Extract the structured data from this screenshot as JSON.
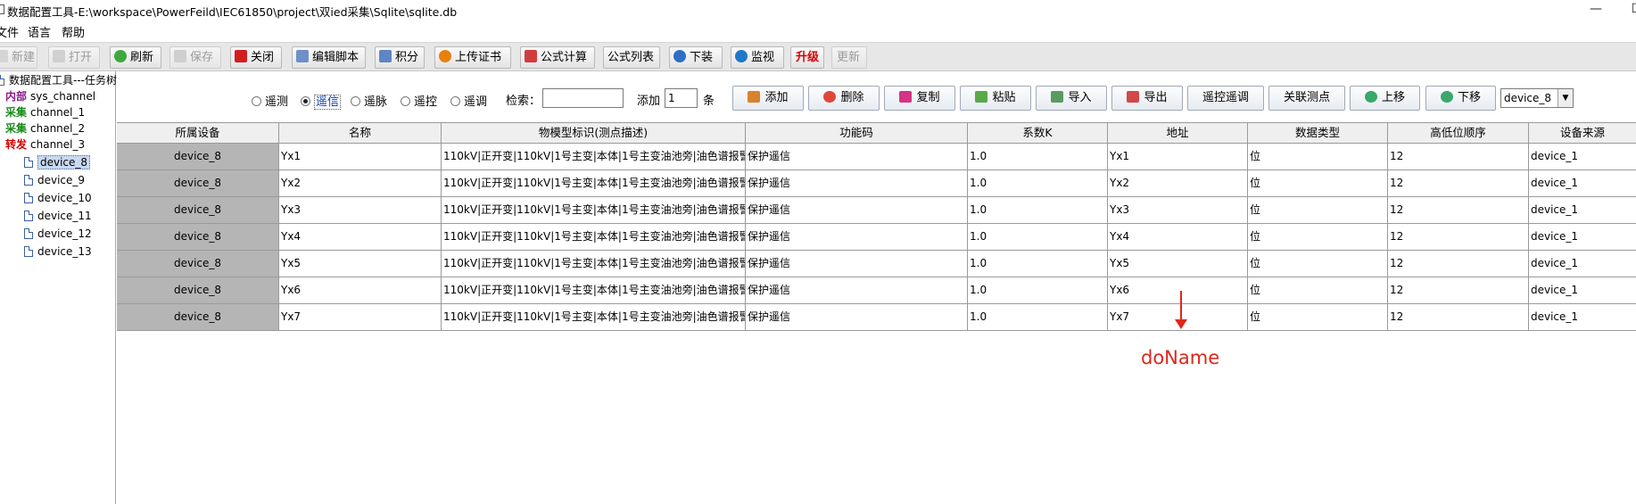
{
  "window": {
    "title": "数据配置工具-E:\\workspace\\PowerFeild\\IEC61850\\project\\双ied采集\\Sqlite\\sqlite.db",
    "minimize_glyph": "—",
    "maximize_glyph": "☐"
  },
  "menu": [
    "文件",
    "语言",
    "帮助"
  ],
  "toolbar": [
    {
      "label": "新建",
      "icon": "new-file-icon",
      "enabled": false
    },
    {
      "label": "打开",
      "icon": "open-folder-icon",
      "enabled": false
    },
    {
      "label": "刷新",
      "icon": "refresh-icon",
      "enabled": true
    },
    {
      "label": "保存",
      "icon": "save-icon",
      "enabled": false
    },
    {
      "label": "关闭",
      "icon": "power-icon",
      "enabled": true
    },
    {
      "label": "编辑脚本",
      "icon": "script-icon",
      "enabled": true
    },
    {
      "label": "积分",
      "icon": "integral-icon",
      "enabled": true
    },
    {
      "label": "上传证书",
      "icon": "certificate-icon",
      "enabled": true
    },
    {
      "label": "公式计算",
      "icon": "formula-icon",
      "enabled": true
    },
    {
      "label": "公式列表",
      "icon": "",
      "enabled": true
    },
    {
      "label": "下装",
      "icon": "download-icon",
      "enabled": true
    },
    {
      "label": "监视",
      "icon": "monitor-icon",
      "enabled": true
    },
    {
      "label": "升级",
      "icon": "",
      "enabled": true
    },
    {
      "label": "更新",
      "icon": "",
      "enabled": false
    }
  ],
  "tree": {
    "root": "数据配置工具---任务树",
    "nodes": [
      {
        "tag": "内部",
        "tag_color": "#8b1a8b",
        "name": "sys_channel"
      },
      {
        "tag": "采集",
        "tag_color": "#1a8b1a",
        "name": "channel_1"
      },
      {
        "tag": "采集",
        "tag_color": "#1a8b1a",
        "name": "channel_2"
      },
      {
        "tag": "转发",
        "tag_color": "#d40000",
        "name": "channel_3"
      }
    ],
    "devices": [
      "device_8",
      "device_9",
      "device_10",
      "device_11",
      "device_12",
      "device_13"
    ],
    "selected": "device_8"
  },
  "filter": {
    "types": [
      "遥测",
      "遥信",
      "遥脉",
      "遥控",
      "遥调"
    ],
    "selected": "遥信",
    "search_label": "检索：",
    "search_value": "",
    "add_label": "添加",
    "add_count": "1",
    "add_unit": "条"
  },
  "actions": [
    {
      "label": "添加",
      "icon": "add-icon"
    },
    {
      "label": "删除",
      "icon": "delete-icon"
    },
    {
      "label": "复制",
      "icon": "copy-icon"
    },
    {
      "label": "粘贴",
      "icon": "paste-icon"
    },
    {
      "label": "导入",
      "icon": "import-icon"
    },
    {
      "label": "导出",
      "icon": "export-icon"
    },
    {
      "label": "遥控遥调",
      "icon": ""
    },
    {
      "label": "关联测点",
      "icon": ""
    },
    {
      "label": "上移",
      "icon": "arrow-up-icon"
    },
    {
      "label": "下移",
      "icon": "arrow-down-icon"
    }
  ],
  "device_select": "device_8",
  "table": {
    "columns": [
      "所属设备",
      "名称",
      "物模型标识(测点描述)",
      "功能码",
      "系数K",
      "地址",
      "数据类型",
      "高低位顺序",
      "设备来源"
    ],
    "rows": [
      [
        "device_8",
        "Yx1",
        "110kV|正开变|110kV|1号主变|本体|1号主变油池旁|油色谱报警...",
        "保护遥信",
        "1.0",
        "Yx1",
        "位",
        "12",
        "device_1"
      ],
      [
        "device_8",
        "Yx2",
        "110kV|正开变|110kV|1号主变|本体|1号主变油池旁|油色谱报警...",
        "保护遥信",
        "1.0",
        "Yx2",
        "位",
        "12",
        "device_1"
      ],
      [
        "device_8",
        "Yx3",
        "110kV|正开变|110kV|1号主变|本体|1号主变油池旁|油色谱报警...",
        "保护遥信",
        "1.0",
        "Yx3",
        "位",
        "12",
        "device_1"
      ],
      [
        "device_8",
        "Yx4",
        "110kV|正开变|110kV|1号主变|本体|1号主变油池旁|油色谱报警...",
        "保护遥信",
        "1.0",
        "Yx4",
        "位",
        "12",
        "device_1"
      ],
      [
        "device_8",
        "Yx5",
        "110kV|正开变|110kV|1号主变|本体|1号主变油池旁|油色谱报警...",
        "保护遥信",
        "1.0",
        "Yx5",
        "位",
        "12",
        "device_1"
      ],
      [
        "device_8",
        "Yx6",
        "110kV|正开变|110kV|1号主变|本体|1号主变油池旁|油色谱报警...",
        "保护遥信",
        "1.0",
        "Yx6",
        "位",
        "12",
        "device_1"
      ],
      [
        "device_8",
        "Yx7",
        "110kV|正开变|110kV|1号主变|本体|1号主变油池旁|油色谱报警...",
        "保护遥信",
        "1.0",
        "Yx7",
        "位",
        "12",
        "device_1"
      ]
    ]
  },
  "annotation": {
    "text": "doName",
    "color": "#e0261c"
  }
}
